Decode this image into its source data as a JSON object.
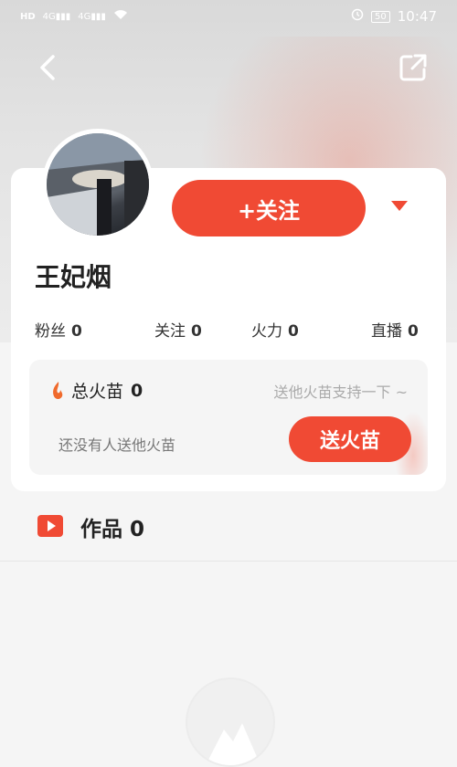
{
  "status_bar": {
    "left_icons": [
      "HD",
      "4G",
      "signal",
      "4G",
      "signal",
      "wifi"
    ],
    "battery": "50",
    "time": "10:47"
  },
  "header": {
    "back_icon": "chevron-left-icon",
    "share_icon": "share-icon"
  },
  "profile": {
    "name": "王妃烟",
    "follow_label": "+关注",
    "stats": [
      {
        "label": "粉丝",
        "value": "0"
      },
      {
        "label": "关注",
        "value": "0"
      },
      {
        "label": "火力",
        "value": "0"
      },
      {
        "label": "直播",
        "value": "0"
      }
    ]
  },
  "fire": {
    "total_label": "总火苗",
    "total_value": "0",
    "hint": "送他火苗支持一下 ~",
    "empty_text": "还没有人送他火苗",
    "send_label": "送火苗"
  },
  "works": {
    "label": "作品",
    "count": "0"
  },
  "colors": {
    "accent": "#f04a34",
    "background": "#f5f5f5"
  }
}
